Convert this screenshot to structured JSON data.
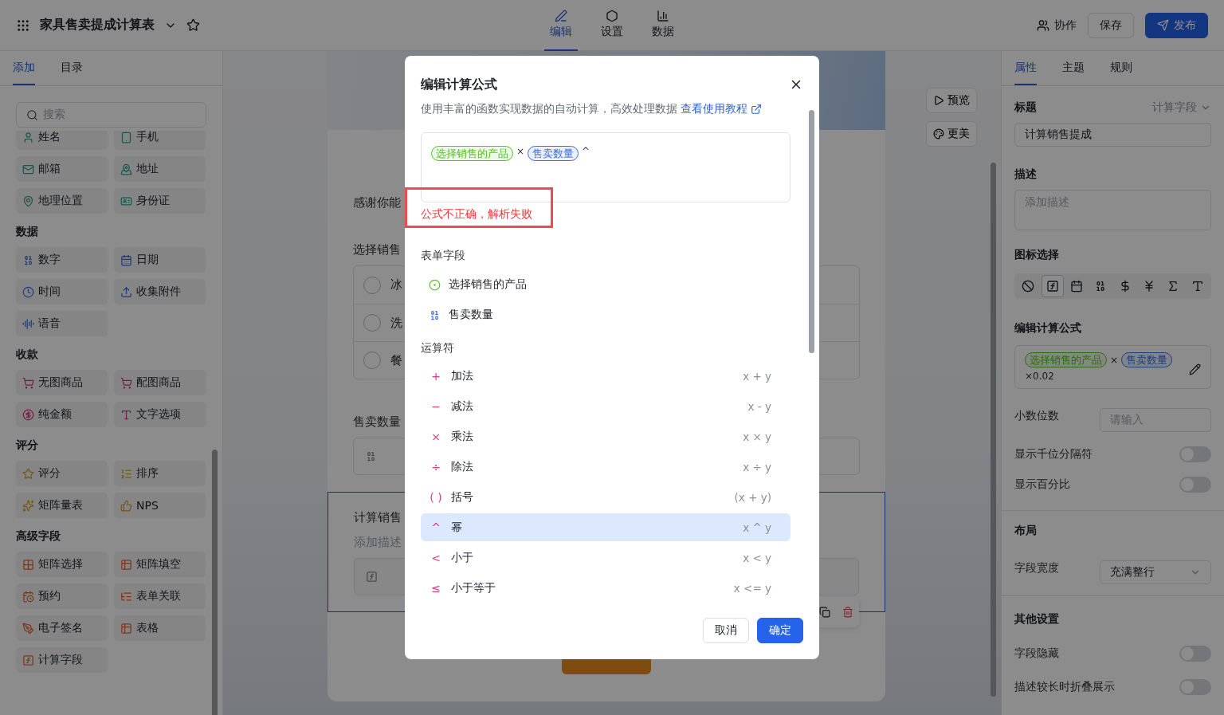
{
  "header": {
    "title": "家具售卖提成计算表",
    "nav_tabs": [
      {
        "label": "编辑",
        "selected": true
      },
      {
        "label": "设置",
        "selected": false
      },
      {
        "label": "数据",
        "selected": false
      }
    ],
    "collaborate": "协作",
    "save": "保存",
    "publish": "发布"
  },
  "left_panel": {
    "tabs": [
      {
        "label": "添加",
        "selected": true
      },
      {
        "label": "目录",
        "selected": false
      }
    ],
    "search": {
      "placeholder": "搜索"
    },
    "groups": [
      {
        "items": [
          "姓名",
          "手机",
          "邮箱",
          "地址",
          "地理位置",
          "身份证"
        ]
      },
      {
        "title": "数据",
        "items": [
          "数字",
          "日期",
          "时间",
          "收集附件",
          "语音"
        ]
      },
      {
        "title": "收款",
        "items": [
          "无图商品",
          "配图商品",
          "纯金额",
          "文字选项"
        ]
      },
      {
        "title": "评分",
        "items": [
          "评分",
          "排序",
          "矩阵量表",
          "NPS"
        ]
      },
      {
        "title": "高级字段",
        "items": [
          "矩阵选择",
          "矩阵填空",
          "预约",
          "表单关联",
          "电子签名",
          "表格",
          "计算字段"
        ]
      }
    ]
  },
  "canvas": {
    "intro": "感谢你能",
    "question_1": {
      "title": "选择销售",
      "options": [
        "冰",
        "洗",
        "餐"
      ]
    },
    "question_2": {
      "title": "售卖数量"
    },
    "question_3": {
      "title": "计算销售",
      "description_placeholder": "添加描述",
      "selected": true
    },
    "preview": "预览",
    "beautify": "更美"
  },
  "dialog": {
    "title": "编辑计算公式",
    "description": "使用丰富的函数实现数据的自动计算，高效处理数据",
    "tutorial_link": "查看使用教程",
    "formula": [
      {
        "kind": "radio_field",
        "text": "选择销售的产品"
      },
      {
        "kind": "op",
        "text": "×"
      },
      {
        "kind": "number_field",
        "text": "售卖数量"
      },
      {
        "kind": "op",
        "text": "^"
      }
    ],
    "error": "公式不正确，解析失败",
    "fields_title": "表单字段",
    "fields": [
      {
        "kind": "radio",
        "label": "选择销售的产品"
      },
      {
        "kind": "number",
        "label": "售卖数量"
      }
    ],
    "operators_title": "运算符",
    "operators": [
      {
        "symbol": "+",
        "label": "加法",
        "example": "x + y",
        "selected": false
      },
      {
        "symbol": "−",
        "label": "减法",
        "example": "x - y",
        "selected": false
      },
      {
        "symbol": "×",
        "label": "乘法",
        "example": "x × y",
        "selected": false
      },
      {
        "symbol": "÷",
        "label": "除法",
        "example": "x ÷ y",
        "selected": false
      },
      {
        "symbol": "( )",
        "label": "括号",
        "example": "(x + y)",
        "selected": false
      },
      {
        "symbol": "^",
        "label": "幂",
        "example": "x ^ y",
        "selected": true
      },
      {
        "symbol": "<",
        "label": "小于",
        "example": "x < y",
        "selected": false
      },
      {
        "symbol": "≤",
        "label": "小于等于",
        "example": "x <= y",
        "selected": false
      }
    ],
    "cancel": "取消",
    "confirm": "确定"
  },
  "right_panel": {
    "tabs": [
      {
        "label": "属性",
        "selected": true
      },
      {
        "label": "主题",
        "selected": false
      },
      {
        "label": "规则",
        "selected": false
      }
    ],
    "title_label": "标题",
    "field_type": "计算字段",
    "title_value": "计算销售提成",
    "description_label": "描述",
    "description_placeholder": "添加描述",
    "icon_label": "图标选择",
    "icon_options": [
      {
        "selected": false
      },
      {
        "selected": true
      },
      {
        "selected": false
      },
      {
        "selected": false
      },
      {
        "selected": false
      },
      {
        "selected": false
      },
      {
        "selected": false
      },
      {
        "selected": false
      }
    ],
    "formula_label": "编辑计算公式",
    "formula": [
      {
        "kind": "radio_field",
        "text": "选择销售的产品"
      },
      {
        "kind": "op",
        "text": "×"
      },
      {
        "kind": "number_field",
        "text": "售卖数量"
      },
      {
        "kind": "op",
        "text": "×0.02"
      }
    ],
    "decimals_label": "小数位数",
    "decimals_placeholder": "请输入",
    "toggles_1": [
      {
        "label": "显示千位分隔符",
        "on": false
      },
      {
        "label": "显示百分比",
        "on": false
      }
    ],
    "layout_title": "布局",
    "width_label": "字段宽度",
    "width_value": "充满整行",
    "other_title": "其他设置",
    "toggles_2": [
      {
        "label": "字段隐藏",
        "on": false
      },
      {
        "label": "描述较长时折叠展示",
        "on": false
      }
    ]
  }
}
